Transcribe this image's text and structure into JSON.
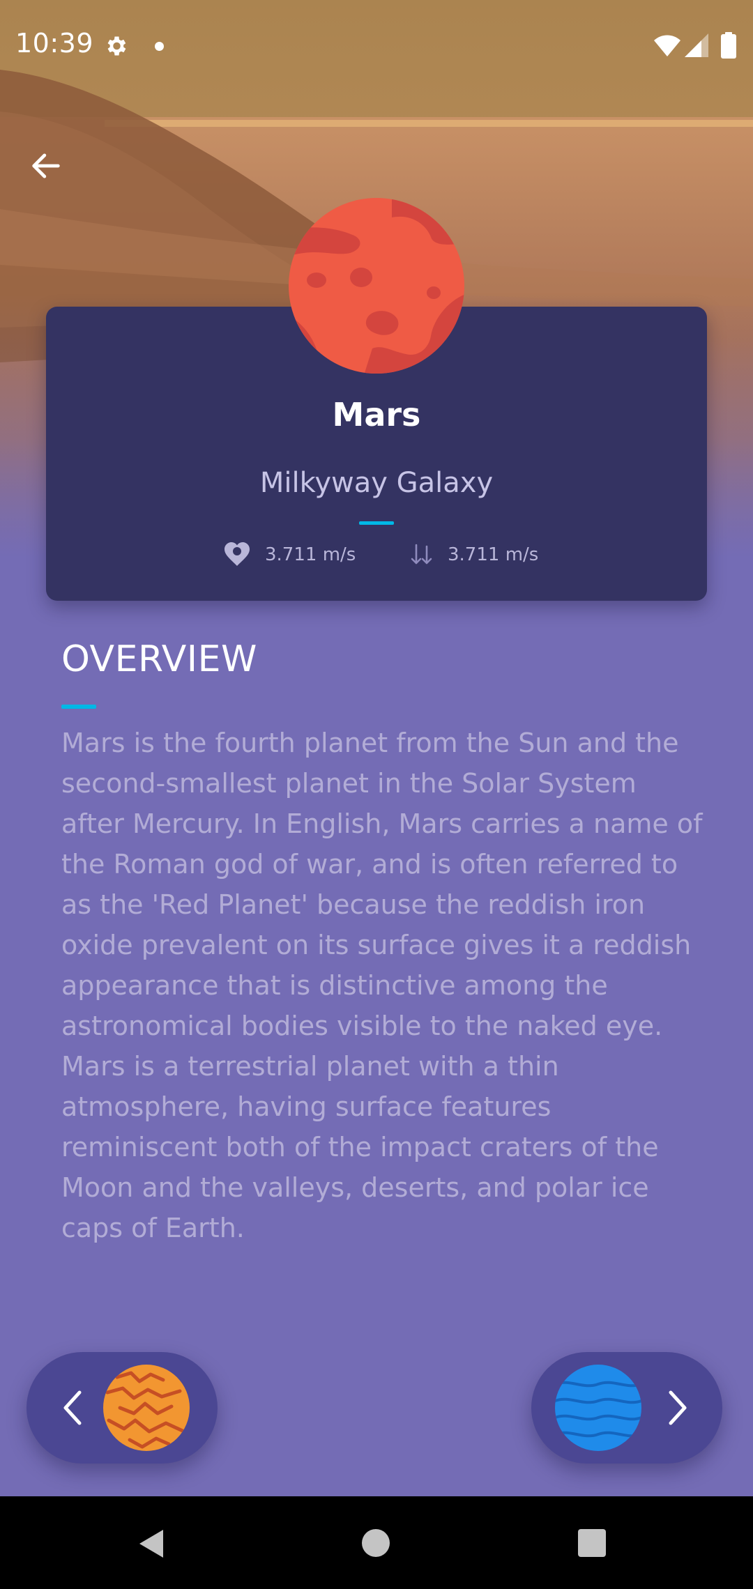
{
  "status_bar": {
    "time": "10:39"
  },
  "planet": {
    "name": "Mars",
    "galaxy": "Milkyway Galaxy",
    "gravity": "3.711 m/s",
    "velocity": "3.711 m/s"
  },
  "overview": {
    "title": "OVERVIEW",
    "description": "Mars is the fourth planet from the Sun and the second-smallest planet in the Solar System after Mercury. In English, Mars carries a name of the Roman god of war, and is often referred to as the 'Red Planet' because the reddish iron oxide prevalent on its surface gives it a reddish appearance that is distinctive among the astronomical bodies visible to the naked eye. Mars is a terrestrial planet with a thin atmosphere, having surface features reminiscent both of the impact craters of the Moon and the valleys, deserts, and polar ice caps of Earth."
  },
  "navigation": {
    "previous_icon": "chevron-left-icon",
    "next_icon": "chevron-right-icon",
    "previous_planet_icon": "jupiter-planet-icon",
    "next_planet_icon": "neptune-planet-icon"
  },
  "colors": {
    "background": "#746cb5",
    "card": "#343362",
    "accent": "#00b8e6",
    "planet": "#ef5b45",
    "pill": "#4b4793"
  }
}
